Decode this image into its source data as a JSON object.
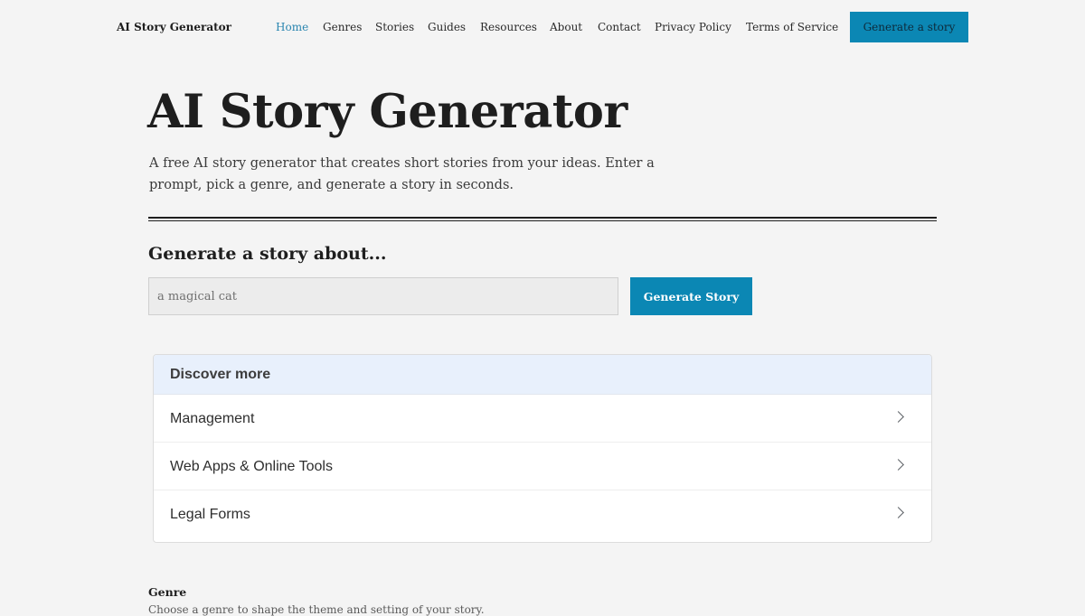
{
  "header": {
    "site_title": "AI Story Generator",
    "nav": [
      {
        "label": "Home",
        "active": true
      },
      {
        "label": "Genres"
      },
      {
        "label": "Stories"
      },
      {
        "label": "Guides"
      },
      {
        "label": "Resources"
      },
      {
        "label": "About"
      },
      {
        "label": "Contact"
      },
      {
        "label": "Privacy Policy"
      },
      {
        "label": "Terms of Service"
      }
    ],
    "cta_label": "Generate a story"
  },
  "hero": {
    "title": "AI Story Generator",
    "description": "A free AI story generator that creates short stories from your ideas. Enter a prompt, pick a genre, and generate a story in seconds."
  },
  "generator": {
    "heading": "Generate a story about...",
    "input_placeholder": "a magical cat",
    "input_value": "",
    "button_label": "Generate Story"
  },
  "discover": {
    "heading": "Discover more",
    "items": [
      {
        "label": "Management",
        "icon": "chevron-right-icon"
      },
      {
        "label": "Web Apps & Online Tools",
        "icon": "chevron-right-icon"
      },
      {
        "label": "Legal Forms",
        "icon": "chevron-right-icon"
      }
    ]
  },
  "genre": {
    "label": "Genre",
    "help_text": "Choose a genre to shape the theme and setting of your story."
  },
  "colors": {
    "accent": "#0b87b4",
    "active_nav": "#2b86b0",
    "page_background": "#f4f4f4",
    "discover_header_background": "#e8f0fc"
  }
}
